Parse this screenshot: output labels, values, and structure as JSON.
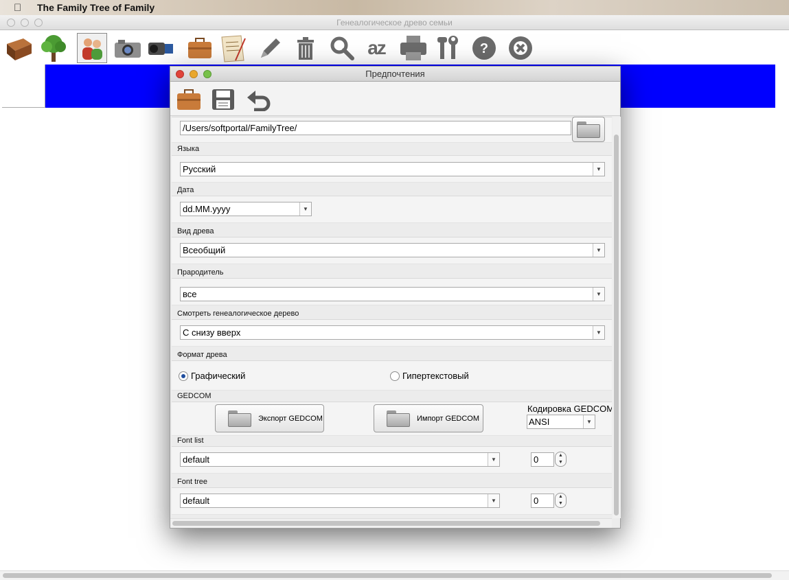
{
  "menubar": {
    "app_name": "The Family Tree of Family"
  },
  "main_window": {
    "title": "Генеалогическое древо семьи",
    "toolbar": [
      "book-icon",
      "tree-icon",
      "people-icon",
      "camera-icon",
      "video-camera-icon",
      "briefcase-icon",
      "notes-icon",
      "pencil-icon",
      "trash-icon",
      "search-icon",
      "sort-az-icon",
      "printer-icon",
      "tools-icon",
      "help-icon",
      "close-icon"
    ],
    "sort_label": "az",
    "band_color": "#0000ff"
  },
  "dialog": {
    "title": "Предпочтения",
    "toolbar": [
      "briefcase-icon",
      "save-icon",
      "undo-icon"
    ],
    "path": "/Users/softportal/FamilyTree/",
    "sections": {
      "language": {
        "label": "Языка",
        "value": "Русский"
      },
      "date": {
        "label": "Дата",
        "value": "dd.MM.yyyy"
      },
      "tree_type": {
        "label": "Вид древа",
        "value": "Всеобщий"
      },
      "ancestor": {
        "label": "Прародитель",
        "value": "все"
      },
      "view_direction": {
        "label": "Смотреть генеалогическое дерево",
        "value": "С снизу вверх"
      },
      "tree_format": {
        "label": "Формат древа",
        "option1": "Графический",
        "option2": "Гипертекстовый",
        "selected": "Графический"
      },
      "gedcom": {
        "label": "GEDCOM",
        "export": "Экспорт GEDCOM",
        "import": "Импорт GEDCOM",
        "encoding_label": "Кодировка GEDCOM",
        "encoding": "ANSI"
      },
      "font_list": {
        "label": "Font list",
        "value": "default",
        "size": "0"
      },
      "font_tree": {
        "label": "Font tree",
        "value": "default",
        "size": "0"
      }
    }
  }
}
